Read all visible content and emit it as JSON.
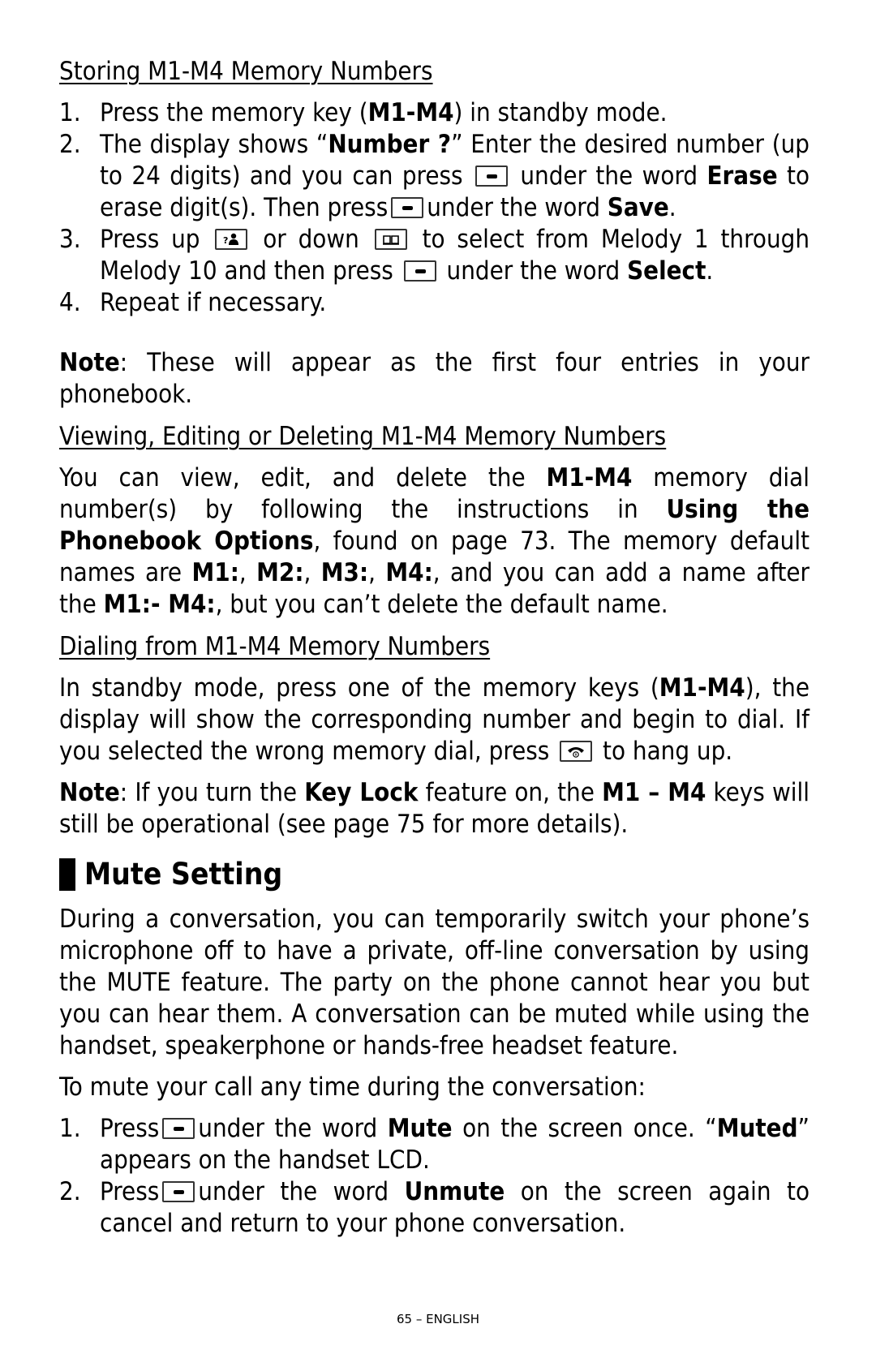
{
  "page": {
    "footer": "65 – ENGLISH"
  },
  "icons": {
    "softkey": "softkey-dash-icon",
    "up_key": "caller-id-up-icon",
    "down_key": "phonebook-down-icon",
    "end_key": "hang-up-icon"
  },
  "storing": {
    "heading": "Storing M1-M4 Memory Numbers",
    "steps": [
      {
        "num": "1.",
        "t1": "Press the memory key (",
        "b1": "M1-M4",
        "t2": ") in standby mode."
      },
      {
        "num": "2.",
        "t1": "The display shows “",
        "b1": "Number ?",
        "t2": "”  Enter the desired number (up to 24 digits) and you can press",
        "t3": "under the word",
        "b2": "Erase",
        "t4": "to erase digit(s).  Then press",
        "t5": "under the word",
        "b3": "Save",
        "t6": "."
      },
      {
        "num": "3.",
        "t1": "Press up",
        "t2": "or down",
        "t3": "to select from Melody 1 through Melody 10 and then press",
        "t4": "under the word",
        "b1": "Select",
        "t5": "."
      },
      {
        "num": "4.",
        "t1": "Repeat if necessary."
      }
    ],
    "note_label": "Note",
    "note_text": ": These will appear as the first four entries in your phonebook."
  },
  "viewing": {
    "heading": "Viewing, Editing or Deleting M1-M4 Memory Numbers",
    "t1": "You can view, edit, and delete the",
    "b1": "M1-M4",
    "t2": "memory dial number(s) by following the instructions in",
    "b2": "Using the Phonebook Options",
    "t3": ", found on page 73. The memory default names are",
    "b3": "M1:",
    "t4": ",",
    "b4": "M2:",
    "t5": ",",
    "b5": "M3:",
    "t6": ",",
    "b6": "M4:",
    "t7": ", and you can add a name after the",
    "b7": "M1:- M4:",
    "t8": ", but you can’t delete the default name."
  },
  "dialing": {
    "heading": "Dialing from M1-M4 Memory Numbers",
    "t1": "In standby mode, press one of the memory keys (",
    "b1": "M1-M4",
    "t2": "), the display will show the corresponding number and begin to dial. If you selected the wrong memory dial, press",
    "t3": "to hang up.",
    "note_label": "Note",
    "n1": ": If you turn the",
    "nb1": "Key Lock",
    "n2": "feature on, the",
    "nb2": "M1 – M4",
    "n3": "keys will still be operational (see page 75 for more details)."
  },
  "mute": {
    "heading": "Mute Setting",
    "intro": "During a conversation, you can temporarily switch your phone’s microphone off to have a private, off-line conversation by using the MUTE feature. The party on the phone cannot hear you but you can hear them. A conversation can be muted while using the handset, speakerphone or hands-free headset feature.",
    "lead": "To mute your call any time during the conversation:",
    "steps": [
      {
        "num": "1.",
        "t1": "Press",
        "t2": "under the word",
        "b1": "Mute",
        "t3": "on the screen once. “",
        "b2": "Muted",
        "t4": "” appears on the handset LCD."
      },
      {
        "num": "2.",
        "t1": "Press",
        "t2": "under the word",
        "b1": "Unmute",
        "t3": "on the screen again to cancel and return to your phone conversation."
      }
    ]
  }
}
